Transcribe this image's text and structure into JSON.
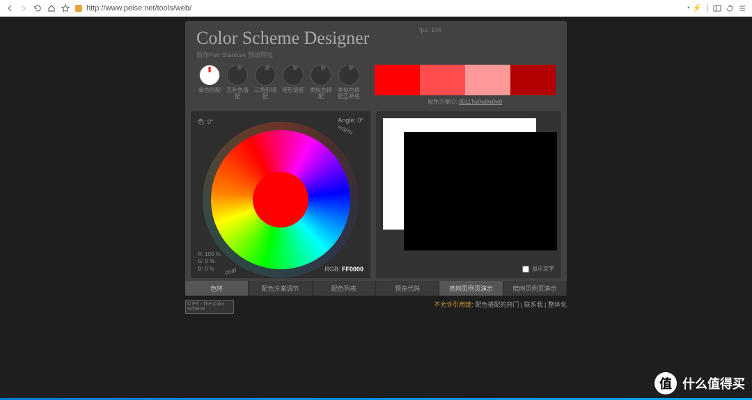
{
  "browser": {
    "url": "http://www.peise.net/tools/web/"
  },
  "header": {
    "title": "Color Scheme Designer",
    "subtitle": "前作Petr Stanicek 预设网址",
    "fps": "fps: 106"
  },
  "schemes": [
    {
      "label": "单色搭配",
      "active": true
    },
    {
      "label": "互补色搭配",
      "active": false
    },
    {
      "label": "三角形搭配",
      "active": false
    },
    {
      "label": "矩形搭配",
      "active": false
    },
    {
      "label": "类似色搭配",
      "active": false
    },
    {
      "label": "类似色搭配互补色",
      "active": false
    }
  ],
  "palette": {
    "colors": [
      "#ff0000",
      "#ff4d4d",
      "#ff9999",
      "#b30000"
    ],
    "id_label": "配色方案ID:",
    "id_value": "0011Tw0w0w0w0"
  },
  "wheel": {
    "hue_label": "色: 0°",
    "angle_label": "Angle: 0°",
    "warm": "warm",
    "cold": "cold",
    "rgb": {
      "r": "R: 100 %",
      "g": "G:    0 %",
      "b": "B:    0 %"
    },
    "hex_label": "RGB:",
    "hex_value": "FF0000"
  },
  "preview": {
    "checkbox_label": "显示文字"
  },
  "tabs_left": [
    {
      "label": "色环",
      "active": true
    },
    {
      "label": "配色方案调节",
      "active": false
    },
    {
      "label": "配色列表",
      "active": false
    }
  ],
  "tabs_right": [
    {
      "label": "预览代码",
      "active": false
    },
    {
      "label": "亮网页例页演示",
      "active": true
    },
    {
      "label": "暗网页例页演示",
      "active": false
    }
  ],
  "footer": {
    "badge": "© PS - The Color Scheme",
    "highlight": "不允许引用链:",
    "links": "配色搭配的窍门 | 联系我 | 整体化"
  },
  "watermark": {
    "icon": "值",
    "text": "什么值得买"
  }
}
